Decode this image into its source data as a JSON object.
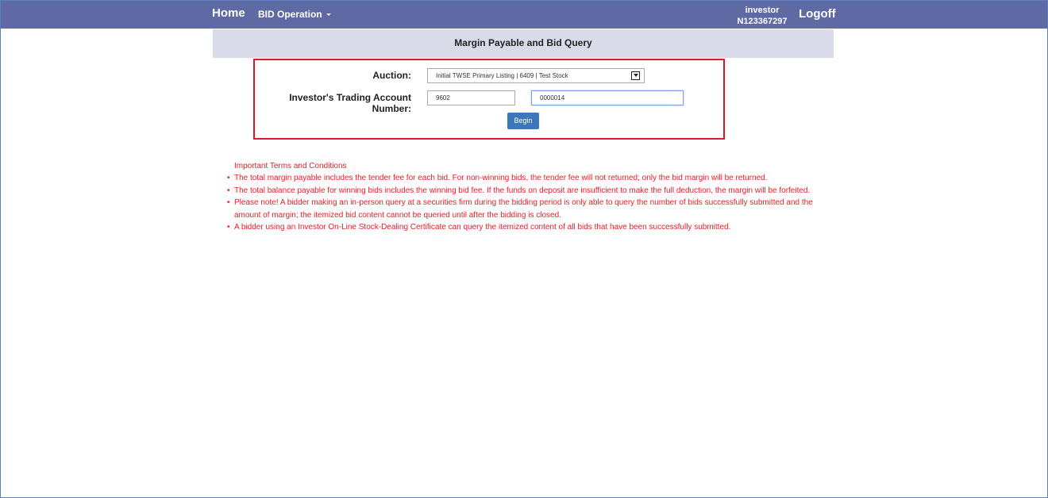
{
  "nav": {
    "home": "Home",
    "bid_operation": "BID Operation",
    "user_role": "investor",
    "user_id": "N123367297",
    "logoff": "Logoff"
  },
  "page": {
    "title": "Margin Payable and Bid Query"
  },
  "form": {
    "auction_label": "Auction:",
    "auction_value": "Initial TWSE Primary Listing | 6409 | Test Stock",
    "account_label": "Investor's Trading Account Number:",
    "account_branch": "9602",
    "account_number": "0000014",
    "begin_button": "Begin"
  },
  "terms": {
    "title": "Important Terms and Conditions",
    "items": [
      "The total margin payable includes the tender fee for each bid. For non-winning bids, the tender fee will not returned; only the bid margin will be returned.",
      "The total balance payable for winning bids includes the winning bid fee. If the funds on deposit are insufficient to make the full deduction, the margin will be forfeited.",
      "Please note! A bidder making an in-person query at a securities firm during the bidding period is only able to query the number of bids successfully submitted and the amount of margin; the itemized bid content cannot be queried until after the bidding is closed.",
      "A bidder using an Investor On-Line Stock-Dealing Certificate can query the itemized content of all bids that have been successfully submitted."
    ]
  },
  "colors": {
    "navbar": "#5f6aa5",
    "title_bar": "#d9dbe8",
    "highlight_border": "#e0162b",
    "terms_text": "#ee1c25",
    "button": "#3a78b9"
  }
}
